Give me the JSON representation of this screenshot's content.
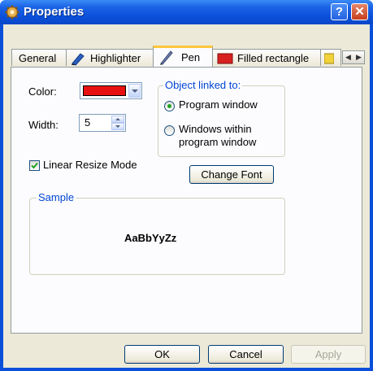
{
  "window": {
    "title": "Properties"
  },
  "titlebar": {
    "help_label": "?",
    "close_label": "✕"
  },
  "tabs": [
    {
      "label": "General",
      "icon": "none",
      "active": false
    },
    {
      "label": "Highlighter",
      "icon": "highlighter-icon",
      "active": false
    },
    {
      "label": "Pen",
      "icon": "pen-icon",
      "active": true
    },
    {
      "label": "Filled rectangle",
      "icon": "filled-rectangle-icon",
      "active": false
    }
  ],
  "tab_scroll": {
    "left": "◀",
    "right": "▶"
  },
  "pen": {
    "color_label": "Color:",
    "color_value": "#e81010",
    "width_label": "Width:",
    "width_value": "5",
    "linear_resize_label": "Linear Resize Mode",
    "linear_resize_checked": true,
    "change_font_label": "Change Font"
  },
  "object_linked": {
    "title": "Object linked to:",
    "options": [
      {
        "label": "Program window",
        "selected": true
      },
      {
        "label": "Windows within",
        "label2": "program window",
        "selected": false
      }
    ]
  },
  "sample": {
    "title": "Sample",
    "text": "AaBbYyZz"
  },
  "footer": {
    "ok_label": "OK",
    "cancel_label": "Cancel",
    "apply_label": "Apply"
  }
}
